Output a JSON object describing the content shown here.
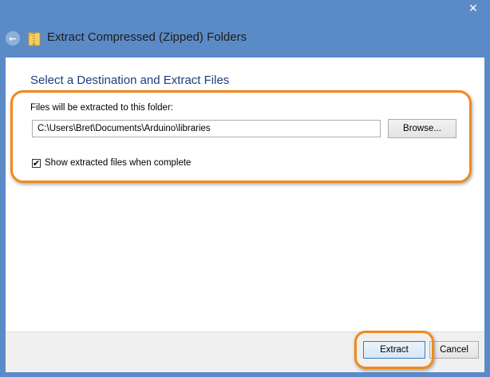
{
  "window": {
    "title": "Extract Compressed (Zipped) Folders",
    "close_glyph": "✕",
    "back_glyph": "←"
  },
  "main": {
    "heading": "Select a Destination and Extract Files",
    "destination_label": "Files will be extracted to this folder:",
    "destination_path": "C:\\Users\\Bret\\Documents\\Arduino\\libraries",
    "browse_label": "Browse...",
    "show_files_checked": true,
    "show_files_check_glyph": "✔",
    "show_files_label": "Show extracted files when complete"
  },
  "footer": {
    "extract_label": "Extract",
    "cancel_label": "Cancel"
  },
  "colors": {
    "title_band": "#5b8bc7",
    "heading_text": "#1f3d7a",
    "highlight": "#f08a1d"
  },
  "icons": {
    "back": "back-arrow-icon",
    "folder": "zipped-folder-icon",
    "close": "close-icon",
    "check": "check-icon"
  }
}
